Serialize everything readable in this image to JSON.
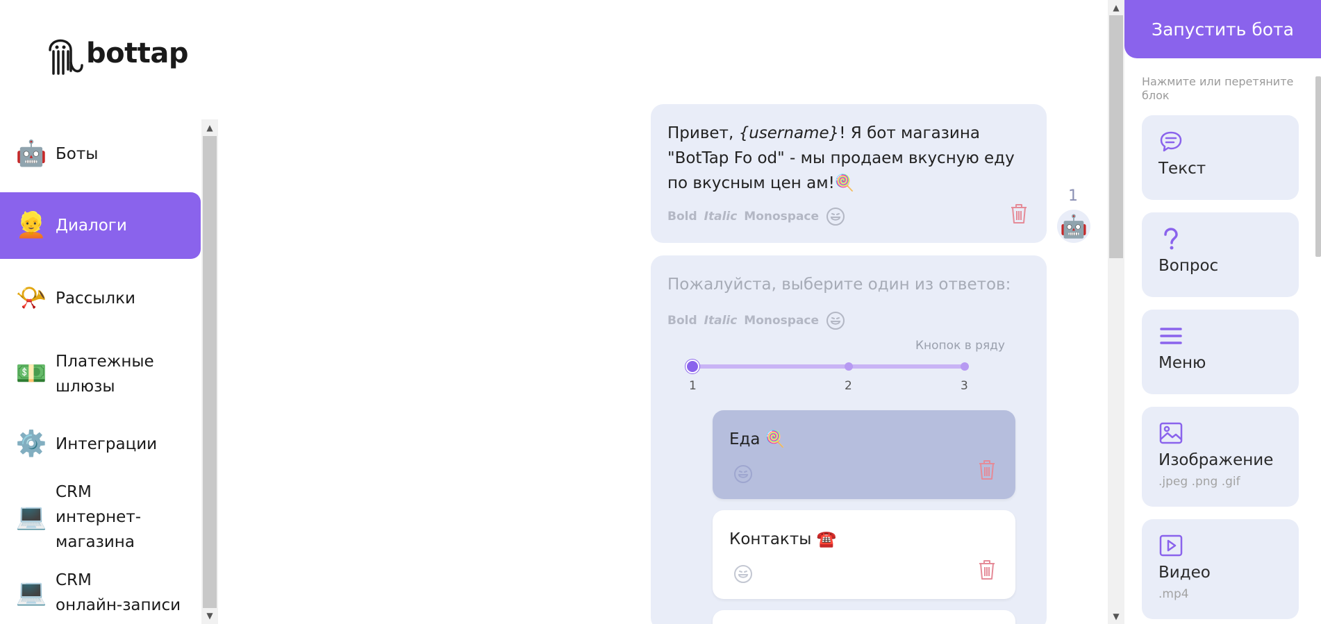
{
  "brand": {
    "name": "bottap"
  },
  "colors": {
    "accent": "#8a63ec",
    "card_bg": "#e9edf8",
    "trash": "#e58b98"
  },
  "sidebar": {
    "items": [
      {
        "label": "Боты",
        "emoji": "🤖"
      },
      {
        "label": "Диалоги",
        "emoji": "👱",
        "active": true
      },
      {
        "label": "Рассылки",
        "emoji": "📯"
      },
      {
        "label": "Платежные\nшлюзы",
        "emoji": "💵"
      },
      {
        "label": "Интеграции",
        "emoji": "⚙️"
      },
      {
        "label": "CRM\nинтернет-\nмагазина",
        "emoji": "💻"
      },
      {
        "label": "CRM\nонлайн-записи",
        "emoji": "💻"
      }
    ]
  },
  "dialog": {
    "messages": [
      {
        "number": "1",
        "text_before": "Привет, ",
        "text_var": "{username}",
        "text_after": "! Я бот магазина \"BotTap Fo od\" - мы продаем вкусную еду по вкусным цен ам!🍭",
        "format": {
          "bold": "Bold",
          "italic": "Italic",
          "mono": "Monospace"
        }
      },
      {
        "placeholder": "Пожалуйста, выберите один из ответов:",
        "format": {
          "bold": "Bold",
          "italic": "Italic",
          "mono": "Monospace"
        },
        "buttons_per_row": {
          "label": "Кнопок в ряду",
          "ticks": [
            "1",
            "2",
            "3"
          ],
          "value": 1
        },
        "answers": [
          {
            "text": "Еда 🍭",
            "highlighted": true
          },
          {
            "text": "Контакты ☎️",
            "highlighted": false
          }
        ]
      }
    ]
  },
  "right_panel": {
    "run_button": "Запустить бота",
    "hint": "Нажмите или перетяните блок",
    "blocks": [
      {
        "title": "Текст",
        "icon": "chat-bubble-icon",
        "sub": ""
      },
      {
        "title": "Вопрос",
        "icon": "question-icon",
        "sub": ""
      },
      {
        "title": "Меню",
        "icon": "menu-icon",
        "sub": ""
      },
      {
        "title": "Изображение",
        "icon": "image-icon",
        "sub": ".jpeg .png .gif"
      },
      {
        "title": "Видео",
        "icon": "video-icon",
        "sub": ".mp4"
      }
    ]
  }
}
